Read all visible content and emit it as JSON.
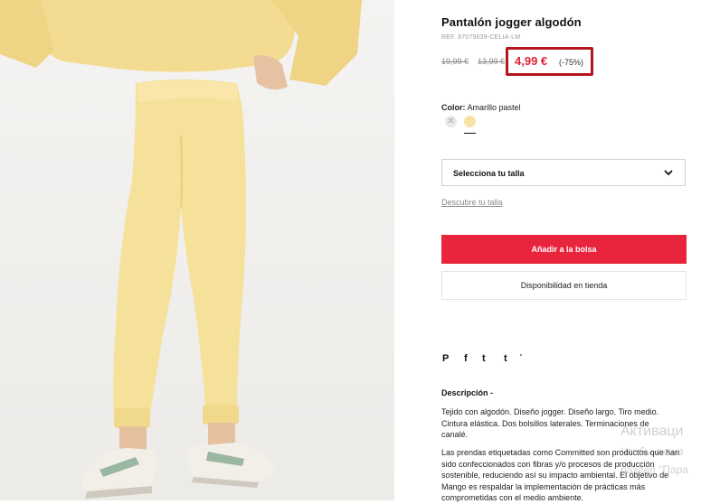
{
  "product": {
    "title": "Pantalón jogger algodón",
    "ref": "REF. 87079639-CELIA-LM",
    "old_price_1": "19,99 €",
    "old_price_2": "13,99 €",
    "price": "4,99 €",
    "discount": "(-75%)"
  },
  "color": {
    "label": "Color:",
    "value": "Amarillo pastel",
    "swatches": [
      "unavailable",
      "amarillo-pastel"
    ],
    "selected_hex": "#f6e3a7"
  },
  "size": {
    "select_label": "Selecciona tu talla",
    "guide_link": "Descubre tu talla"
  },
  "actions": {
    "add_to_bag": "Añadir a la bolsa",
    "store_availability": "Disponibilidad en tienda",
    "accent_color": "#e8253c"
  },
  "social": {
    "icons": [
      "pinterest-icon",
      "facebook-icon",
      "twitter-icon",
      "tumblr-icon",
      "more-icon"
    ],
    "pinterest": "P",
    "facebook": "f",
    "twitter": "t",
    "tumblr": "t",
    "more": "'"
  },
  "description": {
    "title": "Descripción -",
    "p1": "Tejido con algodón. Diseño jogger. Diseño largo. Tiro medio. Cintura elástica. Dos bolsillos laterales. Terminaciones de canalé.",
    "p2": "Las prendas etiquetadas como Committed son productos que han sido confeccionados con fibras y/o procesos de producción sostenible, reduciendo así su impacto ambiental. El objetivo de Mango es respaldar la implementación de prácticas más comprometidas con el medio ambiente."
  },
  "os_watermark": {
    "line1": "Активаци",
    "line2": "Чтобы актив",
    "line3": "раздел \"Пара"
  }
}
